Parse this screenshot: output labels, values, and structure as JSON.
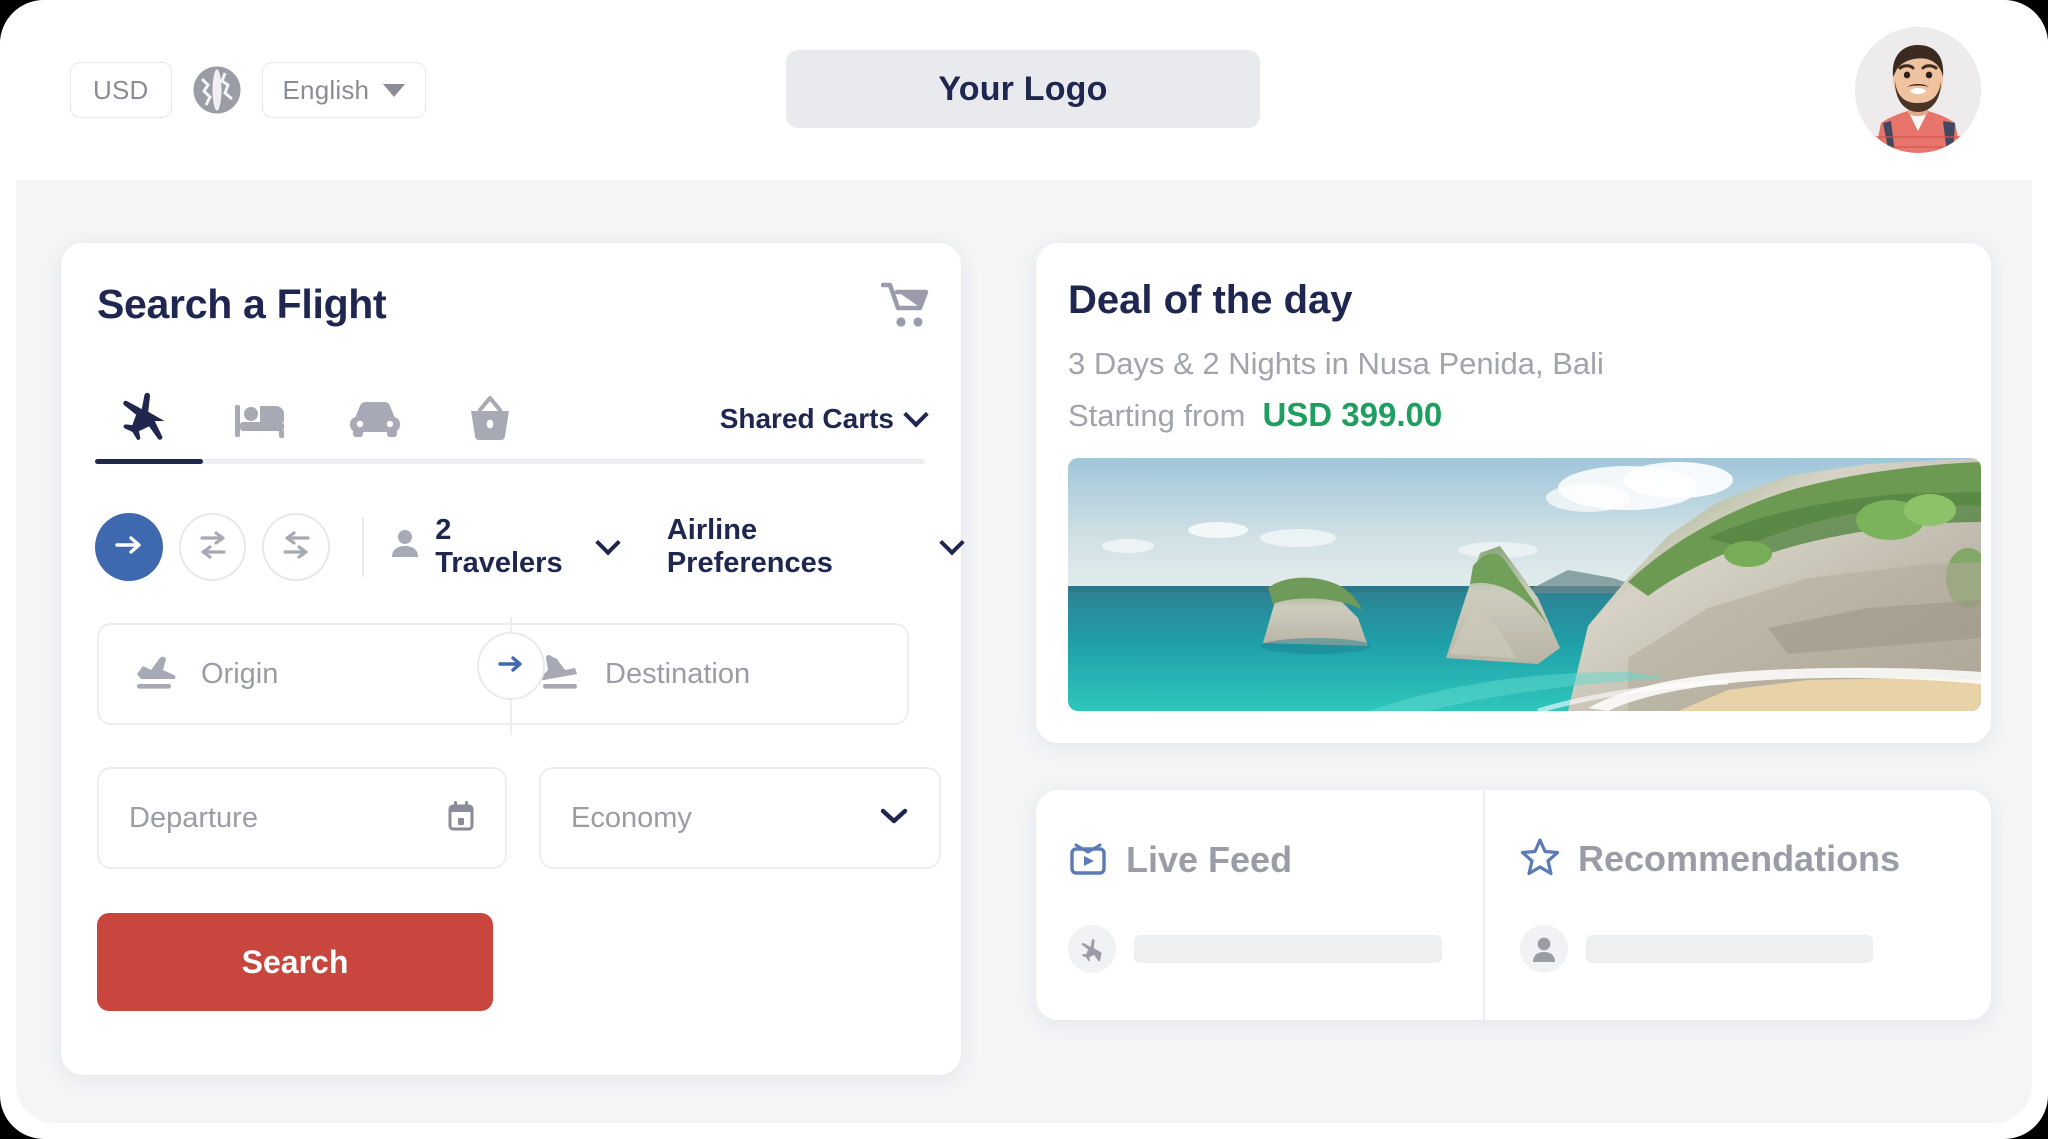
{
  "header": {
    "currency": "USD",
    "globe_icon": "globe-icon",
    "language": "English",
    "logo": "Your Logo",
    "avatar": "user-avatar"
  },
  "search_panel": {
    "title": "Search a Flight",
    "cart_icon": "shopping-cart-icon",
    "tabs": [
      {
        "name": "flights",
        "icon": "airplane-icon",
        "active": true
      },
      {
        "name": "hotels",
        "icon": "bed-icon",
        "active": false
      },
      {
        "name": "cars",
        "icon": "car-icon",
        "active": false
      },
      {
        "name": "packages",
        "icon": "basket-icon",
        "active": false
      }
    ],
    "shared_carts_label": "Shared Carts",
    "trip_types": [
      {
        "name": "one-way",
        "icon": "arrow-right-icon",
        "active": true
      },
      {
        "name": "round-trip",
        "icon": "arrows-up-down-icon",
        "active": false
      },
      {
        "name": "multi-city",
        "icon": "arrows-exchange-icon",
        "active": false
      }
    ],
    "travelers_label": "2 Travelers",
    "airline_preferences_label": "Airline Preferences",
    "origin_placeholder": "Origin",
    "destination_placeholder": "Destination",
    "swap_icon": "arrow-right-icon",
    "departure_placeholder": "Departure",
    "calendar_icon": "calendar-icon",
    "cabin_class": "Economy",
    "search_button": "Search",
    "accent_color": "#c9463f",
    "primary_color": "#1f2750",
    "active_trip_color": "#3f69ae"
  },
  "deal_panel": {
    "title": "Deal of the day",
    "subtitle": "3 Days & 2 Nights in Nusa Penida, Bali",
    "from_label": "Starting from",
    "price": "USD 399.00",
    "price_color": "#1e9e5f",
    "image_alt": "nusa-penida-cliffs-photo"
  },
  "feed_panel": {
    "live_feed": {
      "title": "Live Feed",
      "icon": "live-tv-icon",
      "item_icon": "airplane-icon"
    },
    "recommendations": {
      "title": "Recommendations",
      "icon": "star-icon",
      "item_icon": "person-icon"
    }
  }
}
